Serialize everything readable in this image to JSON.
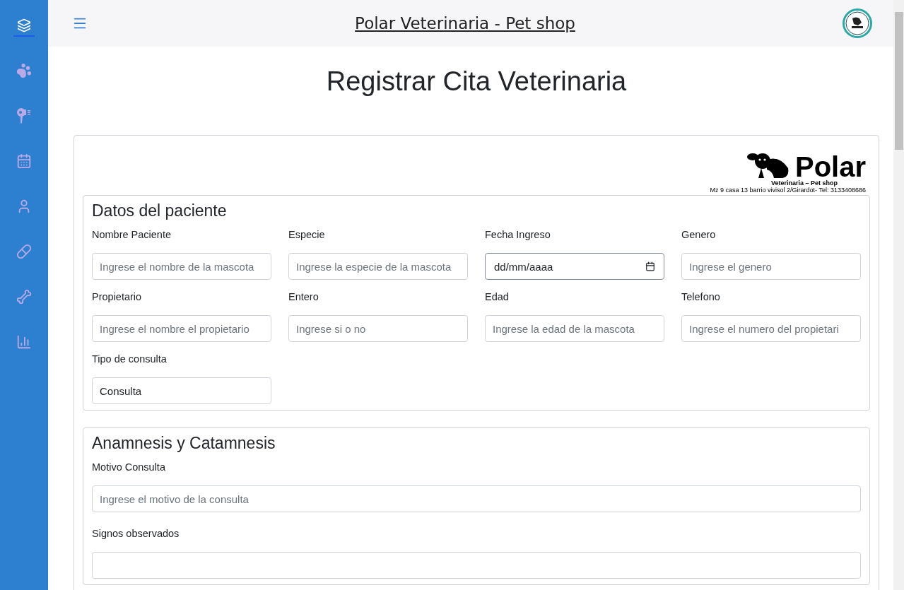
{
  "sidebar": {
    "items": [
      {
        "selected": true
      },
      {
        "selected": false
      },
      {
        "selected": false
      },
      {
        "selected": false
      },
      {
        "selected": false
      },
      {
        "selected": false
      },
      {
        "selected": false
      },
      {
        "selected": false
      }
    ]
  },
  "header": {
    "title": "Polar Veterinaria - Pet shop"
  },
  "page_title": "Registrar Cita Veterinaria",
  "brand": {
    "name": "Polar",
    "tagline": "Veterinaria – Pet shop",
    "address": "Mz 9 casa 13 barrio vivisol 2/Girardot- Tel: 3133408686"
  },
  "sections": [
    {
      "title": "Datos del paciente",
      "kind": "grid",
      "fields": [
        {
          "label": "Nombre Paciente",
          "kind": "text",
          "placeholder": "Ingrese el nombre de la mascota"
        },
        {
          "label": "Especie",
          "kind": "text",
          "placeholder": "Ingrese la especie de la mascota"
        },
        {
          "label": "Fecha Ingreso",
          "kind": "date",
          "value": "dd/mm/aaaa"
        },
        {
          "label": "Genero",
          "kind": "text",
          "placeholder": "Ingrese el genero"
        },
        {
          "label": "Propietario",
          "kind": "text",
          "placeholder": "Ingrese el nombre el propietario"
        },
        {
          "label": "Entero",
          "kind": "text",
          "placeholder": "Ingrese si o no"
        },
        {
          "label": "Edad",
          "kind": "text",
          "placeholder": "Ingrese la edad de la mascota"
        },
        {
          "label": "Telefono",
          "kind": "text",
          "placeholder": "Ingrese el numero del propietari"
        },
        {
          "label": "Tipo de consulta",
          "kind": "text",
          "value": "Consulta"
        }
      ]
    },
    {
      "title": "Anamnesis y Catamnesis",
      "kind": "stack",
      "fields": [
        {
          "label": "Motivo Consulta",
          "kind": "text",
          "placeholder": "Ingrese el motivo de la consulta"
        },
        {
          "label": "Signos observados",
          "kind": "text"
        }
      ]
    }
  ]
}
